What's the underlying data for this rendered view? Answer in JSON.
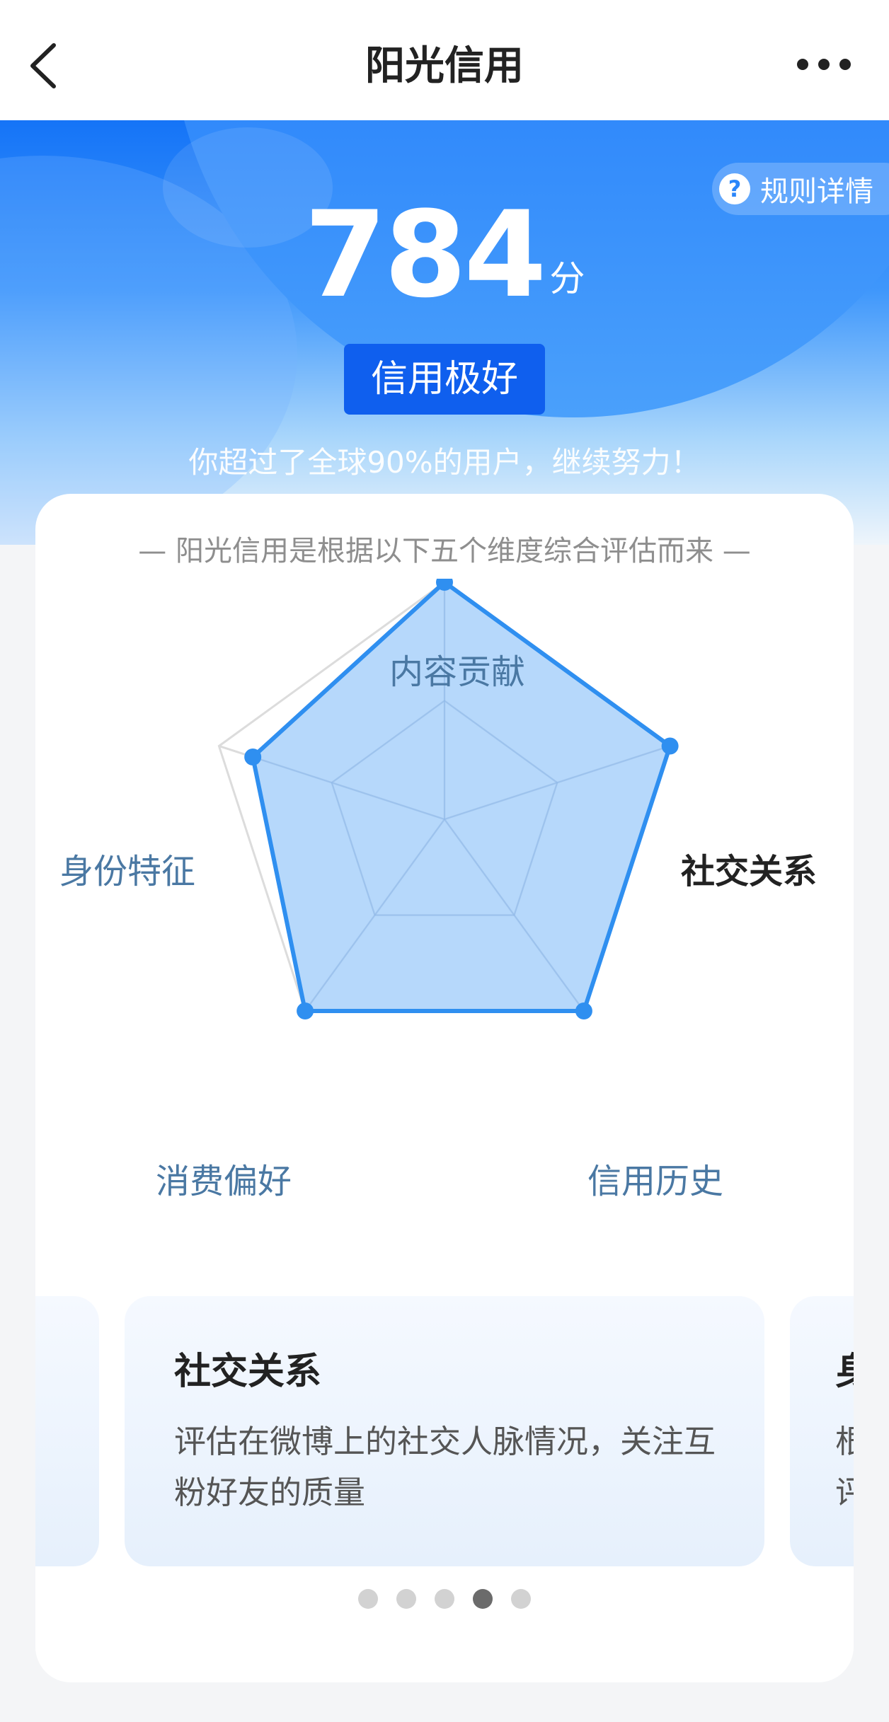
{
  "nav": {
    "title": "阳光信用",
    "back_icon": "chevron-left-icon",
    "more_icon": "more-dots-icon"
  },
  "hero": {
    "rule_button_label": "规则详情",
    "rule_icon": "question-icon",
    "rule_icon_glyph": "?",
    "score": "784",
    "score_unit": "分",
    "level": "信用极好",
    "percent_text": "你超过了全球90%的用户，继续努力！"
  },
  "card": {
    "subtitle": "— 阳光信用是根据以下五个维度综合评估而来 —"
  },
  "radar": {
    "dimensions": [
      "内容贡献",
      "社交关系",
      "信用历史",
      "消费偏好",
      "身份特征"
    ],
    "values": [
      1.0,
      1.0,
      1.0,
      1.0,
      0.85
    ],
    "max": 1.0,
    "active_index": 1,
    "fill_color": "#a6d0fa",
    "line_color": "#2f8ff0",
    "grid_color": "#dcdcdc"
  },
  "slides": {
    "prev_peek": {},
    "current": {
      "title": "社交关系",
      "description": "评估在微博上的社交人脉情况，关注互粉好友的质量"
    },
    "next_peek": {
      "title_partial": "身",
      "desc_partial_line1": "根",
      "desc_partial_line2": "评"
    }
  },
  "pagination": {
    "count": 5,
    "active_index": 3
  },
  "colors": {
    "brand_blue": "#1574f7",
    "badge_blue": "#0f5fee",
    "label_blue": "#4a78a3"
  }
}
